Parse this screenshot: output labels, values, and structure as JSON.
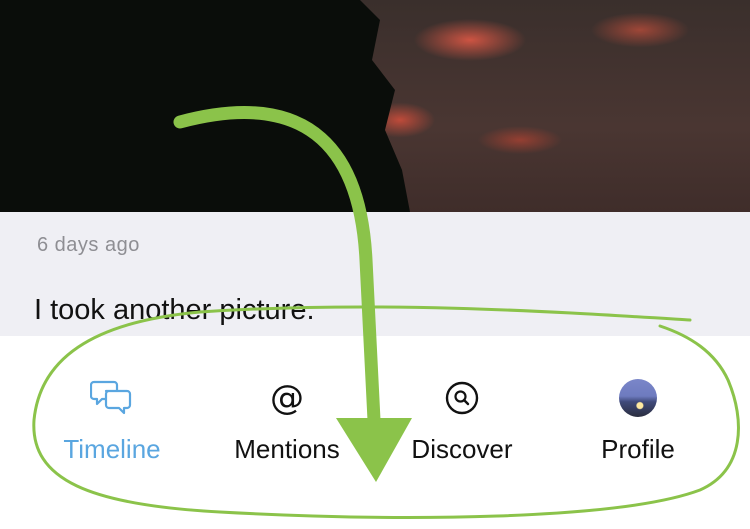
{
  "post": {
    "timestamp": "6 days ago",
    "text": "I took another picture."
  },
  "tabs": [
    {
      "label": "Timeline",
      "icon": "chat-bubbles-icon",
      "active": true
    },
    {
      "label": "Mentions",
      "icon": "at-sign-icon",
      "active": false
    },
    {
      "label": "Discover",
      "icon": "search-icon",
      "active": false
    },
    {
      "label": "Profile",
      "icon": "avatar",
      "active": false
    }
  ],
  "colors": {
    "accent": "#5aa6e0",
    "annotation": "#8bc34a",
    "post_background": "#efeff4"
  }
}
